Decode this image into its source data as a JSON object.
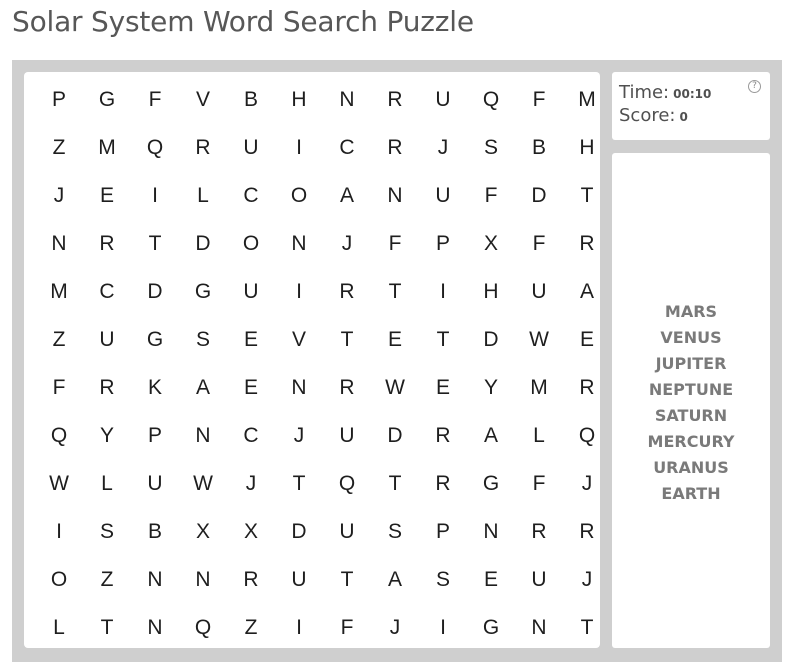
{
  "page": {
    "title": "Solar System Word Search Puzzle"
  },
  "stats": {
    "time_label": "Time:",
    "time_value": "00:10",
    "score_label": "Score:",
    "score_value": "0",
    "help_glyph": "?"
  },
  "grid": {
    "rows": [
      [
        "P",
        "G",
        "F",
        "V",
        "B",
        "H",
        "N",
        "R",
        "U",
        "Q",
        "F",
        "M"
      ],
      [
        "Z",
        "M",
        "Q",
        "R",
        "U",
        "I",
        "C",
        "R",
        "J",
        "S",
        "B",
        "H"
      ],
      [
        "J",
        "E",
        "I",
        "L",
        "C",
        "O",
        "A",
        "N",
        "U",
        "F",
        "D",
        "T"
      ],
      [
        "N",
        "R",
        "T",
        "D",
        "O",
        "N",
        "J",
        "F",
        "P",
        "X",
        "F",
        "R"
      ],
      [
        "M",
        "C",
        "D",
        "G",
        "U",
        "I",
        "R",
        "T",
        "I",
        "H",
        "U",
        "A"
      ],
      [
        "Z",
        "U",
        "G",
        "S",
        "E",
        "V",
        "T",
        "E",
        "T",
        "D",
        "W",
        "E"
      ],
      [
        "F",
        "R",
        "K",
        "A",
        "E",
        "N",
        "R",
        "W",
        "E",
        "Y",
        "M",
        "R"
      ],
      [
        "Q",
        "Y",
        "P",
        "N",
        "C",
        "J",
        "U",
        "D",
        "R",
        "A",
        "L",
        "Q"
      ],
      [
        "W",
        "L",
        "U",
        "W",
        "J",
        "T",
        "Q",
        "T",
        "R",
        "G",
        "F",
        "J"
      ],
      [
        "I",
        "S",
        "B",
        "X",
        "X",
        "D",
        "U",
        "S",
        "P",
        "N",
        "R",
        "R"
      ],
      [
        "O",
        "Z",
        "N",
        "N",
        "R",
        "U",
        "T",
        "A",
        "S",
        "E",
        "U",
        "J"
      ],
      [
        "L",
        "T",
        "N",
        "Q",
        "Z",
        "I",
        "F",
        "J",
        "I",
        "G",
        "N",
        "T"
      ]
    ]
  },
  "words": [
    "MARS",
    "VENUS",
    "JUPITER",
    "NEPTUNE",
    "SATURN",
    "MERCURY",
    "URANUS",
    "EARTH"
  ],
  "colors": {
    "frame": "#cfcfcf",
    "panel": "#ffffff",
    "letter": "#1e1e1e",
    "word": "#7a7a7a",
    "title": "#575757"
  }
}
